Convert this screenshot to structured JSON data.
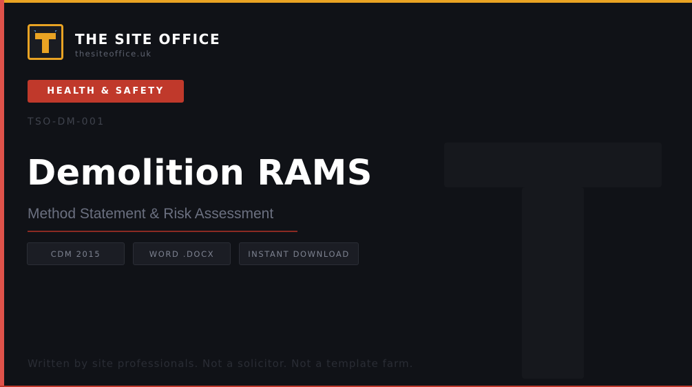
{
  "brand": {
    "logo_letter": "T",
    "name": "THE SITE OFFICE",
    "url": "thesiteoffice.uk"
  },
  "category_badge": "HEALTH & SAFETY",
  "doc_code": "TSO-DM-001",
  "title": "Demolition RAMS",
  "subtitle": "Method Statement & Risk Assessment",
  "tags": [
    "CDM 2015",
    "WORD .DOCX",
    "INSTANT DOWNLOAD"
  ],
  "footer_note": "Written by site professionals. Not a solicitor. Not a template farm.",
  "colors": {
    "background": "#101217",
    "accent_orange": "#e9a323",
    "accent_red": "#c0392b",
    "left_stripe": "#e0524a",
    "title_text": "#ffffff",
    "muted_text": "#6b7080"
  },
  "icons": {
    "logo": "t-logo-icon",
    "watermark": "t-watermark-icon"
  }
}
